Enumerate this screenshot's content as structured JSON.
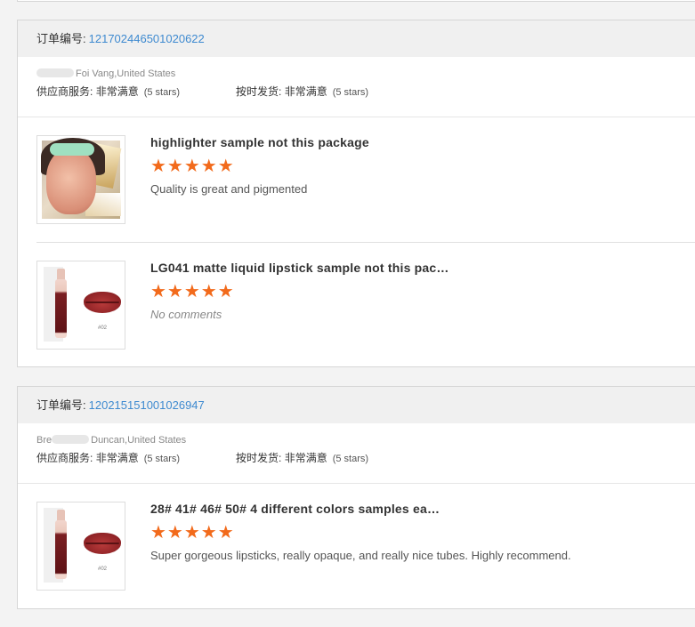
{
  "orders": [
    {
      "order_label": "订单编号:",
      "order_number": "121702446501020622",
      "buyer": "Foi Vang,United States",
      "supplier_service_label": "供应商服务:",
      "supplier_service_value": "非常满意",
      "supplier_service_stars": "(5 stars)",
      "on_time_label": "按时发货:",
      "on_time_value": "非常满意",
      "on_time_stars": "(5 stars)",
      "items": [
        {
          "title": "highlighter sample not this package",
          "stars": "★★★★★",
          "rating": 5,
          "comment": "Quality is great and pigmented"
        },
        {
          "title": "LG041 matte liquid lipstick sample not this pac…",
          "stars": "★★★★★",
          "rating": 5,
          "comment": "No comments"
        }
      ]
    },
    {
      "order_label": "订单编号:",
      "order_number": "120215151001026947",
      "buyer": "Duncan,United States",
      "buyer_prefix": "Bre",
      "supplier_service_label": "供应商服务:",
      "supplier_service_value": "非常满意",
      "supplier_service_stars": "(5 stars)",
      "on_time_label": "按时发货:",
      "on_time_value": "非常满意",
      "on_time_stars": "(5 stars)",
      "items": [
        {
          "title": "28# 41# 46# 50# 4 different colors samples ea…",
          "stars": "★★★★★",
          "rating": 5,
          "comment": "Super gorgeous lipsticks, really opaque, and really nice tubes. Highly recommend."
        }
      ]
    }
  ],
  "shade_label": "#02",
  "colors": {
    "order_number": "#3e8ad0",
    "star": "#f26a1b",
    "header_bg": "#f0f0f0"
  }
}
